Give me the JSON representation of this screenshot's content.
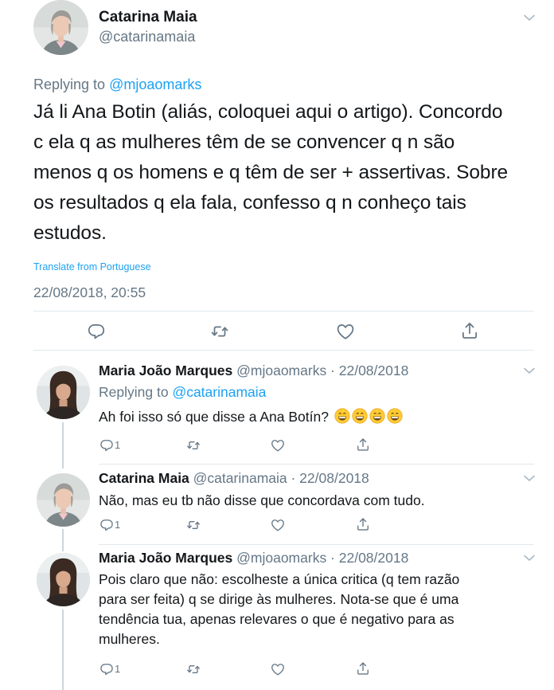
{
  "main_tweet": {
    "name": "Catarina Maia",
    "handle": "@catarinamaia",
    "replying_label": "Replying to",
    "replying_handle": "@mjoaomarks",
    "text_lines": [
      "Já li Ana Botin (aliás, coloquei aqui o artigo). Concordo",
      "c ela q as mulheres têm de se convencer q n são",
      "menos q os homens e q têm de ser + assertivas. Sobre",
      "os resultados q ela fala, confesso q n conheço tais",
      "estudos."
    ],
    "translate_label": "Translate from Portuguese",
    "timestamp": "22/08/2018, 20:55"
  },
  "replies": [
    {
      "name": "Maria João Marques",
      "meta": "@mjoaomarks · 22/08/2018",
      "replying_label": "Replying to",
      "replying_handle": "@catarinamaia",
      "text_lines": [
        "Ah foi isso só que disse a Ana Botín?"
      ],
      "emoji": [
        "grinning-face",
        "grinning-face",
        "grinning-face",
        "grinning-face"
      ],
      "reply_count": "1"
    },
    {
      "name": "Catarina Maia",
      "meta": "@catarinamaia · 22/08/2018",
      "text_lines": [
        "Não, mas eu tb não disse que concordava com tudo."
      ],
      "reply_count": "1"
    },
    {
      "name": "Maria João Marques",
      "meta": "@mjoaomarks · 22/08/2018",
      "text_lines": [
        "Pois claro que não: escolheste a única critica (q tem razão",
        "para ser feita) q se dirige às mulheres. Nota-se que é uma",
        "tendência tua, apenas relevares o que é negativo para as",
        "mulheres."
      ],
      "reply_count": "1"
    }
  ],
  "icons": {
    "reply": "reply-icon",
    "retweet": "retweet-icon",
    "like": "heart-icon",
    "share": "share-icon",
    "more": "chevron-down-icon"
  },
  "colors": {
    "link": "#1da1f2",
    "secondary_text": "#657786",
    "divider": "#e1e8ed",
    "thread_line": "#ccd6dd"
  }
}
